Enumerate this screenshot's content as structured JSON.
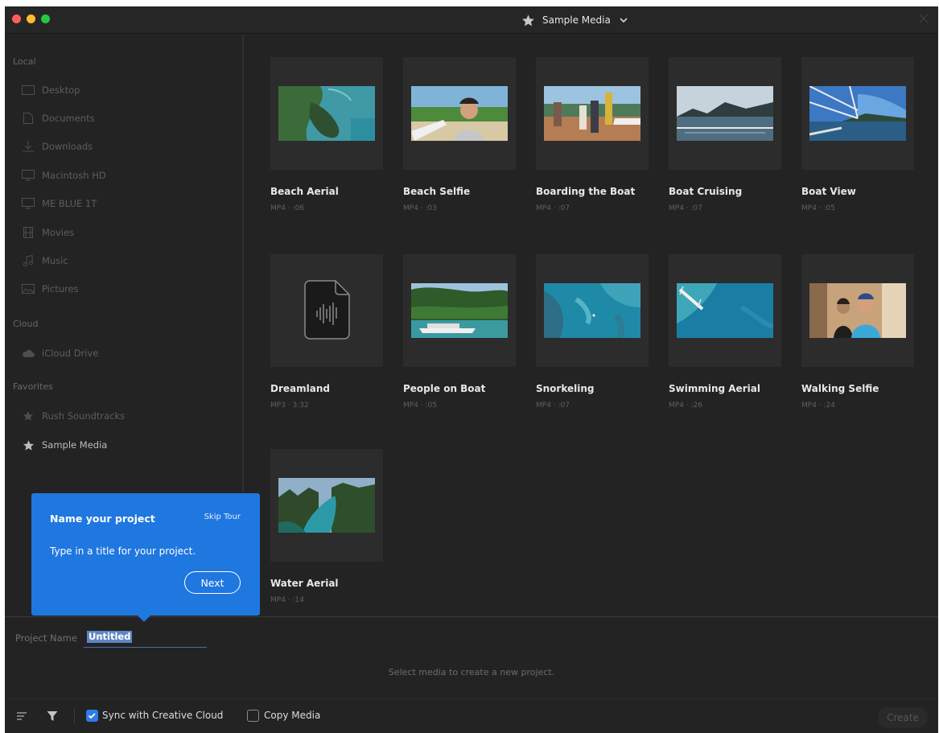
{
  "window": {
    "title": "Sample Media"
  },
  "sidebar": {
    "sections": [
      {
        "heading": "Local"
      },
      {
        "heading": "Cloud"
      },
      {
        "heading": "Favorites"
      }
    ],
    "local_items": [
      {
        "label": "Desktop",
        "icon": "desktop-icon"
      },
      {
        "label": "Documents",
        "icon": "document-icon"
      },
      {
        "label": "Downloads",
        "icon": "download-icon"
      },
      {
        "label": "Macintosh HD",
        "icon": "monitor-icon"
      },
      {
        "label": "ME BLUE 1T",
        "icon": "monitor-icon"
      },
      {
        "label": "Movies",
        "icon": "film-icon"
      },
      {
        "label": "Music",
        "icon": "music-icon"
      },
      {
        "label": "Pictures",
        "icon": "picture-icon"
      }
    ],
    "cloud_items": [
      {
        "label": "iCloud Drive",
        "icon": "cloud-icon"
      }
    ],
    "favorite_items": [
      {
        "label": "Rush Soundtracks",
        "icon": "star-icon"
      },
      {
        "label": "Sample Media",
        "icon": "star-icon"
      }
    ]
  },
  "media": [
    {
      "title": "Beach Aerial",
      "meta": "MP4 · :06"
    },
    {
      "title": "Beach Selfie",
      "meta": "MP4 · :03"
    },
    {
      "title": "Boarding the Boat",
      "meta": "MP4 · :07"
    },
    {
      "title": "Boat Cruising",
      "meta": "MP4 · :07"
    },
    {
      "title": "Boat View",
      "meta": "MP4 · :05"
    },
    {
      "title": "Dreamland",
      "meta": "MP3 · 3:32"
    },
    {
      "title": "People on Boat",
      "meta": "MP4 · :05"
    },
    {
      "title": "Snorkeling",
      "meta": "MP4 · :07"
    },
    {
      "title": "Swimming Aerial",
      "meta": "MP4 · :26"
    },
    {
      "title": "Walking Selfie",
      "meta": "MP4 · :24"
    },
    {
      "title": "Water Aerial",
      "meta": "MP4 · :14"
    }
  ],
  "project": {
    "name_label": "Project Name",
    "name_value": "Untitled",
    "hint": "Select media to create a new project."
  },
  "footer": {
    "sync_label": "Sync with Creative Cloud",
    "sync_checked": true,
    "copy_label": "Copy Media",
    "copy_checked": false,
    "create_label": "Create"
  },
  "tour": {
    "title": "Name your project",
    "skip_label": "Skip Tour",
    "body": "Type in a title for your project.",
    "next_label": "Next"
  },
  "colors": {
    "accent": "#1f77e0",
    "background": "#232323",
    "checkbox_on": "#2f7be6"
  }
}
